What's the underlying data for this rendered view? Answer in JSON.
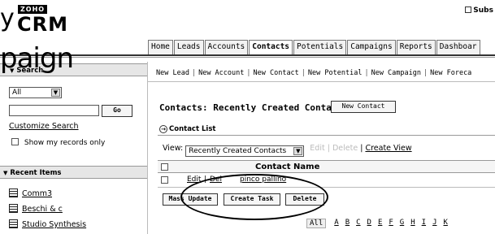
{
  "logo": {
    "overlay_left": "y",
    "zoho": "ZOHO",
    "crm": "CRM"
  },
  "overlay_text": "paign",
  "header": {
    "subscribe": "Subs"
  },
  "tabs": [
    "Home",
    "Leads",
    "Accounts",
    "Contacts",
    "Potentials",
    "Campaigns",
    "Reports",
    "Dashboar"
  ],
  "active_tab": "Contacts",
  "sidebar": {
    "search_header": "Search",
    "search_scope": "All",
    "search_value": "",
    "go_label": "Go",
    "customize_search": "Customize Search",
    "show_my_records": "Show my records only",
    "recent_header": "Recent Items",
    "recent_items": [
      "Comm3",
      "Beschi & c",
      "Studio Synthesis"
    ]
  },
  "quick_links": [
    "New Lead",
    "New Account",
    "New Contact",
    "New Potential",
    "New Campaign",
    "New Foreca"
  ],
  "main": {
    "title": "Contacts: Recently Created Contacts",
    "new_contact_button": "New Contact",
    "list_label": "Contact List",
    "view_label": "View:",
    "view_value": "Recently Created Contacts",
    "edit_link": "Edit",
    "delete_link": "Delete",
    "create_view_link": "Create View",
    "column_header": "Contact Name",
    "row": {
      "edit": "Edit",
      "sep": "|",
      "del": "Del",
      "name": "pinco pallino"
    },
    "mass_update_button": "Mass Update",
    "create_task_button": "Create Task",
    "delete_button": "Delete"
  },
  "alphabet": [
    "All",
    "A",
    "B",
    "C",
    "D",
    "E",
    "F",
    "G",
    "H",
    "I",
    "J",
    "K"
  ]
}
